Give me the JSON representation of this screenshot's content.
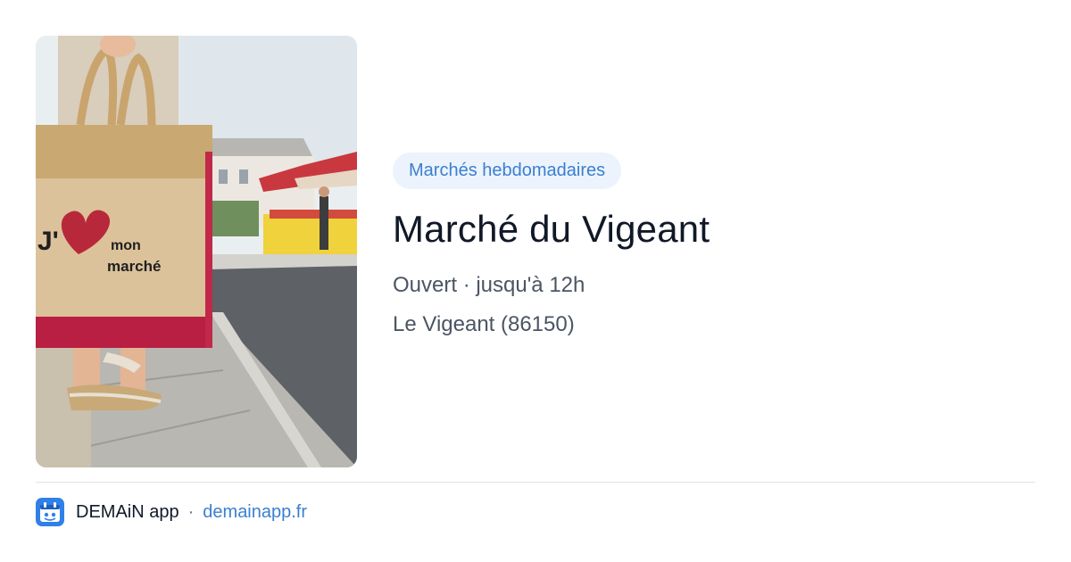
{
  "card": {
    "category": "Marchés hebdomadaires",
    "title": "Marché du Vigeant",
    "status": "Ouvert · jusqu'à 12h",
    "location": "Le Vigeant (86150)"
  },
  "photo": {
    "bag_print_line1": "J'",
    "bag_print_line2": "mon",
    "bag_print_line3": "marché"
  },
  "footer": {
    "app_name": "DEMAiN app",
    "separator": "·",
    "site": "demainapp.fr"
  },
  "colors": {
    "accent": "#3b7fd0",
    "badge_bg": "#ecf3fc",
    "title": "#111827",
    "muted": "#4b5563"
  }
}
